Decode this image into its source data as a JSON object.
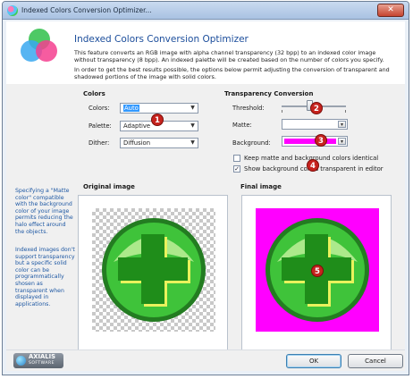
{
  "window": {
    "title": "Indexed Colors Conversion Optimizer...",
    "close_label": "✕"
  },
  "header": {
    "title": "Indexed Colors Conversion Optimizer",
    "desc1": "This feature converts an RGB image with alpha channel transparency (32 bpp) to an indexed color image without transparency (8 bpp). An indexed palette will be created based on the number of colors you specify.",
    "desc2": "In order to get the best results possible, the options below permit adjusting the conversion of transparent and shadowed portions of the image with solid colors."
  },
  "colors_group": {
    "title": "Colors",
    "colors_label": "Colors:",
    "colors_value": "Auto",
    "palette_label": "Palette:",
    "palette_value": "Adaptive",
    "dither_label": "Dither:",
    "dither_value": "Diffusion"
  },
  "transparency_group": {
    "title": "Transparency Conversion",
    "threshold_label": "Threshold:",
    "threshold_level": 0.43,
    "matte_label": "Matte:",
    "matte_color": "#ffffff",
    "background_label": "Background:",
    "background_color": "#ff00ff",
    "keep_identical_label": "Keep matte and background colors identical",
    "keep_identical_checked": false,
    "show_transparent_label": "Show background colors transparent in editor",
    "show_transparent_checked": true
  },
  "markers": [
    "1",
    "2",
    "3",
    "4",
    "5"
  ],
  "side_notes": {
    "note1": "Specifying a \"Matte color\" compatible with the background color of your image permits reducing the halo effect around the objects.",
    "note2": "Indexed images don't support transparency but a specific solid color can be programmatically shosen as transparent when displayed in applications."
  },
  "previews": {
    "original_label": "Original image",
    "final_label": "Final image"
  },
  "footer": {
    "brand_name": "AXIALIS",
    "brand_sub": "SOFTWARE",
    "ok_label": "OK",
    "cancel_label": "Cancel"
  },
  "colors": {
    "accent": "#1b4d9b",
    "marker": "#c6231e",
    "icon_green": "#2fb52a"
  }
}
